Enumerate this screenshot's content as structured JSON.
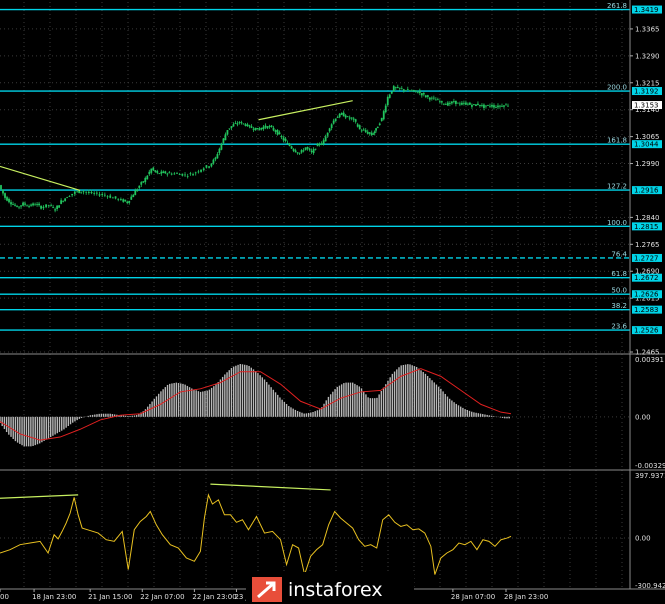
{
  "colors": {
    "background": "#000000",
    "candles": "#22c55e",
    "fib_lines": "#00d4e8",
    "trend_lines": "#c8f060",
    "macd_hist": "#b8b8b8",
    "macd_signal": "#e02020",
    "oscillator": "#e8c020",
    "logo_bg": "#e84e3a",
    "price_tag": "#ffffff"
  },
  "branding": {
    "logo_icon": "instaforex-arrow-icon",
    "logo_text": "instaforex"
  },
  "chart_data": [
    {
      "type": "candlestick",
      "ylim": [
        1.2465,
        1.344
      ],
      "current_price": "1.3153",
      "price_ticks": [
        "1.3365",
        "1.3290",
        "1.3215",
        "1.3140",
        "1.3065",
        "1.2990",
        "1.2840",
        "1.2765",
        "1.2690",
        "1.2615",
        "1.2465"
      ],
      "fib_levels": [
        {
          "label": "261.8",
          "price": 1.3419,
          "tag": "1.3419"
        },
        {
          "label": "200.0",
          "price": 1.3192,
          "tag": "1.3192"
        },
        {
          "label": "161.8",
          "price": 1.3044,
          "tag": "1.3044"
        },
        {
          "label": "127.2",
          "price": 1.2916,
          "tag": "1.2916"
        },
        {
          "label": "100.0",
          "price": 1.2815,
          "tag": "1.2815"
        },
        {
          "label": "76.4",
          "price": 1.2727,
          "tag": "1.2727"
        },
        {
          "label": "61.8",
          "price": 1.2672,
          "tag": "1.2672"
        },
        {
          "label": "50.0",
          "price": 1.2626,
          "tag": "1.2626"
        },
        {
          "label": "38.2",
          "price": 1.2583,
          "tag": "1.2583"
        },
        {
          "label": "23.6",
          "price": 1.2526,
          "tag": "1.2526"
        }
      ],
      "price_path": [
        [
          0,
          1.293
        ],
        [
          6,
          1.2895
        ],
        [
          12,
          1.288
        ],
        [
          18,
          1.2868
        ],
        [
          24,
          1.2878
        ],
        [
          30,
          1.2872
        ],
        [
          36,
          1.2878
        ],
        [
          42,
          1.2868
        ],
        [
          50,
          1.2875
        ],
        [
          56,
          1.2862
        ],
        [
          62,
          1.2885
        ],
        [
          68,
          1.2898
        ],
        [
          76,
          1.291
        ],
        [
          82,
          1.2913
        ],
        [
          90,
          1.2908
        ],
        [
          98,
          1.2905
        ],
        [
          106,
          1.2902
        ],
        [
          114,
          1.2895
        ],
        [
          122,
          1.2888
        ],
        [
          128,
          1.2882
        ],
        [
          134,
          1.2905
        ],
        [
          140,
          1.2928
        ],
        [
          146,
          1.2948
        ],
        [
          152,
          1.2975
        ],
        [
          158,
          1.2962
        ],
        [
          164,
          1.2965
        ],
        [
          170,
          1.2962
        ],
        [
          178,
          1.2962
        ],
        [
          186,
          1.2958
        ],
        [
          194,
          1.2962
        ],
        [
          202,
          1.2975
        ],
        [
          210,
          1.2985
        ],
        [
          216,
          1.3005
        ],
        [
          222,
          1.3045
        ],
        [
          228,
          1.3085
        ],
        [
          234,
          1.3098
        ],
        [
          240,
          1.3105
        ],
        [
          246,
          1.3098
        ],
        [
          252,
          1.309
        ],
        [
          258,
          1.3085
        ],
        [
          264,
          1.3092
        ],
        [
          270,
          1.3092
        ],
        [
          276,
          1.308
        ],
        [
          282,
          1.3062
        ],
        [
          288,
          1.3045
        ],
        [
          294,
          1.3028
        ],
        [
          300,
          1.3018
        ],
        [
          306,
          1.3035
        ],
        [
          312,
          1.302
        ],
        [
          318,
          1.3042
        ],
        [
          324,
          1.3052
        ],
        [
          330,
          1.3092
        ],
        [
          336,
          1.3118
        ],
        [
          342,
          1.3128
        ],
        [
          348,
          1.3118
        ],
        [
          354,
          1.3112
        ],
        [
          360,
          1.3085
        ],
        [
          366,
          1.3078
        ],
        [
          372,
          1.307
        ],
        [
          376,
          1.3085
        ],
        [
          382,
          1.3115
        ],
        [
          388,
          1.3175
        ],
        [
          394,
          1.3202
        ],
        [
          400,
          1.3198
        ],
        [
          406,
          1.3195
        ],
        [
          412,
          1.3192
        ],
        [
          418,
          1.319
        ],
        [
          424,
          1.318
        ],
        [
          430,
          1.3172
        ],
        [
          436,
          1.3168
        ],
        [
          442,
          1.316
        ],
        [
          448,
          1.3155
        ],
        [
          454,
          1.3162
        ],
        [
          460,
          1.3155
        ],
        [
          466,
          1.3158
        ],
        [
          472,
          1.3152
        ],
        [
          478,
          1.3155
        ],
        [
          484,
          1.3148
        ],
        [
          490,
          1.3152
        ],
        [
          496,
          1.3148
        ],
        [
          502,
          1.3152
        ],
        [
          508,
          1.3153
        ]
      ],
      "trend_lines": [
        {
          "from": [
            0,
            1.2982
          ],
          "to": [
            80,
            1.2915
          ]
        },
        {
          "from": [
            258,
            1.3112
          ],
          "to": [
            352,
            1.3165
          ]
        }
      ]
    },
    {
      "type": "bar",
      "indicator": "MACD",
      "ylim": [
        -0.00329,
        0.00391
      ],
      "ticks": [
        "0.00391",
        "0.00",
        "-0.00329"
      ],
      "histogram": [
        [
          0,
          -0.0004
        ],
        [
          8,
          -0.0011
        ],
        [
          16,
          -0.0016
        ],
        [
          24,
          -0.0019
        ],
        [
          32,
          -0.0019
        ],
        [
          40,
          -0.0017
        ],
        [
          48,
          -0.0014
        ],
        [
          56,
          -0.0011
        ],
        [
          64,
          -0.0008
        ],
        [
          72,
          -0.0004
        ],
        [
          80,
          -0.0001
        ],
        [
          90,
          0.0001
        ],
        [
          100,
          0.0002
        ],
        [
          110,
          0.0002
        ],
        [
          120,
          0.0001
        ],
        [
          128,
          5e-05
        ],
        [
          136,
          0.0001
        ],
        [
          144,
          0.0004
        ],
        [
          152,
          0.001
        ],
        [
          160,
          0.0016
        ],
        [
          168,
          0.0021
        ],
        [
          176,
          0.0022
        ],
        [
          184,
          0.0021
        ],
        [
          192,
          0.0018
        ],
        [
          200,
          0.0016
        ],
        [
          208,
          0.0017
        ],
        [
          216,
          0.0021
        ],
        [
          224,
          0.0027
        ],
        [
          232,
          0.0032
        ],
        [
          240,
          0.0034
        ],
        [
          248,
          0.0033
        ],
        [
          256,
          0.0029
        ],
        [
          264,
          0.0024
        ],
        [
          272,
          0.0018
        ],
        [
          280,
          0.0012
        ],
        [
          288,
          0.0007
        ],
        [
          296,
          0.0004
        ],
        [
          304,
          0.0002
        ],
        [
          312,
          0.0003
        ],
        [
          320,
          0.0005
        ],
        [
          328,
          0.0013
        ],
        [
          336,
          0.0019
        ],
        [
          344,
          0.0022
        ],
        [
          352,
          0.0022
        ],
        [
          360,
          0.0019
        ],
        [
          368,
          0.0012
        ],
        [
          376,
          0.0012
        ],
        [
          384,
          0.002
        ],
        [
          392,
          0.0028
        ],
        [
          400,
          0.0033
        ],
        [
          408,
          0.0034
        ],
        [
          416,
          0.0032
        ],
        [
          424,
          0.0028
        ],
        [
          432,
          0.0023
        ],
        [
          440,
          0.0018
        ],
        [
          448,
          0.0012
        ],
        [
          456,
          0.0008
        ],
        [
          464,
          0.0005
        ],
        [
          472,
          0.0003
        ],
        [
          480,
          0.0002
        ],
        [
          488,
          0.0001
        ],
        [
          496,
          0.0
        ],
        [
          504,
          -0.0001
        ],
        [
          510,
          -0.0001
        ]
      ],
      "signal": [
        [
          0,
          -0.0003
        ],
        [
          20,
          -0.0011
        ],
        [
          40,
          -0.0015
        ],
        [
          60,
          -0.0013
        ],
        [
          80,
          -0.0008
        ],
        [
          100,
          -0.0002
        ],
        [
          120,
          0.0001
        ],
        [
          140,
          0.0002
        ],
        [
          160,
          0.0008
        ],
        [
          180,
          0.0016
        ],
        [
          200,
          0.0018
        ],
        [
          220,
          0.0022
        ],
        [
          240,
          0.0029
        ],
        [
          260,
          0.0029
        ],
        [
          280,
          0.0021
        ],
        [
          300,
          0.001
        ],
        [
          320,
          0.0005
        ],
        [
          340,
          0.0012
        ],
        [
          360,
          0.0016
        ],
        [
          380,
          0.0017
        ],
        [
          400,
          0.0026
        ],
        [
          420,
          0.0031
        ],
        [
          440,
          0.0026
        ],
        [
          460,
          0.0017
        ],
        [
          480,
          0.0008
        ],
        [
          500,
          0.0003
        ],
        [
          510,
          0.0002
        ]
      ]
    },
    {
      "type": "line",
      "indicator": "Oscillator",
      "ylim": [
        -300.942,
        397.9371
      ],
      "ticks": [
        "397.9371",
        "0.00",
        "-300.942"
      ],
      "series": [
        [
          0,
          -90
        ],
        [
          10,
          -70
        ],
        [
          20,
          -40
        ],
        [
          30,
          -30
        ],
        [
          40,
          -20
        ],
        [
          48,
          -90
        ],
        [
          54,
          20
        ],
        [
          58,
          -5
        ],
        [
          62,
          40
        ],
        [
          66,
          90
        ],
        [
          70,
          150
        ],
        [
          74,
          245
        ],
        [
          78,
          140
        ],
        [
          82,
          60
        ],
        [
          90,
          45
        ],
        [
          98,
          30
        ],
        [
          106,
          -10
        ],
        [
          114,
          -20
        ],
        [
          122,
          40
        ],
        [
          128,
          -190
        ],
        [
          134,
          50
        ],
        [
          140,
          100
        ],
        [
          146,
          130
        ],
        [
          150,
          160
        ],
        [
          156,
          80
        ],
        [
          162,
          20
        ],
        [
          170,
          -40
        ],
        [
          178,
          -60
        ],
        [
          186,
          -120
        ],
        [
          194,
          -140
        ],
        [
          200,
          -80
        ],
        [
          204,
          120
        ],
        [
          208,
          260
        ],
        [
          212,
          205
        ],
        [
          218,
          230
        ],
        [
          224,
          140
        ],
        [
          230,
          140
        ],
        [
          236,
          95
        ],
        [
          242,
          110
        ],
        [
          248,
          50
        ],
        [
          256,
          130
        ],
        [
          264,
          30
        ],
        [
          272,
          40
        ],
        [
          280,
          -10
        ],
        [
          286,
          -160
        ],
        [
          292,
          -40
        ],
        [
          298,
          -60
        ],
        [
          304,
          -220
        ],
        [
          310,
          -110
        ],
        [
          316,
          -70
        ],
        [
          322,
          -40
        ],
        [
          328,
          80
        ],
        [
          334,
          160
        ],
        [
          340,
          120
        ],
        [
          346,
          90
        ],
        [
          352,
          60
        ],
        [
          358,
          -10
        ],
        [
          364,
          -50
        ],
        [
          370,
          -40
        ],
        [
          376,
          -60
        ],
        [
          382,
          110
        ],
        [
          388,
          140
        ],
        [
          394,
          95
        ],
        [
          400,
          70
        ],
        [
          406,
          80
        ],
        [
          412,
          50
        ],
        [
          418,
          55
        ],
        [
          424,
          30
        ],
        [
          430,
          -50
        ],
        [
          434,
          -220
        ],
        [
          440,
          -120
        ],
        [
          446,
          -90
        ],
        [
          452,
          -70
        ],
        [
          458,
          -30
        ],
        [
          464,
          -40
        ],
        [
          470,
          -20
        ],
        [
          476,
          -70
        ],
        [
          482,
          -10
        ],
        [
          488,
          -20
        ],
        [
          494,
          -50
        ],
        [
          500,
          -10
        ],
        [
          506,
          0
        ],
        [
          510,
          10
        ]
      ],
      "trend_lines": [
        {
          "from": [
            0,
            240
          ],
          "to": [
            78,
            260
          ]
        },
        {
          "from": [
            210,
            325
          ],
          "to": [
            330,
            290
          ]
        }
      ]
    }
  ],
  "time_axis": [
    {
      "x": 0,
      "label": "00"
    },
    {
      "x": 34,
      "label": "18 Jan 23:00"
    },
    {
      "x": 90,
      "label": "21 Jan 15:00"
    },
    {
      "x": 142,
      "label": "22 Jan 07:00"
    },
    {
      "x": 194,
      "label": "22 Jan 23:00"
    },
    {
      "x": 236,
      "label": "23 Jan"
    },
    {
      "x": 452,
      "label": "28 Jan 07:00"
    },
    {
      "x": 505,
      "label": "28 Jan 23:00"
    }
  ]
}
